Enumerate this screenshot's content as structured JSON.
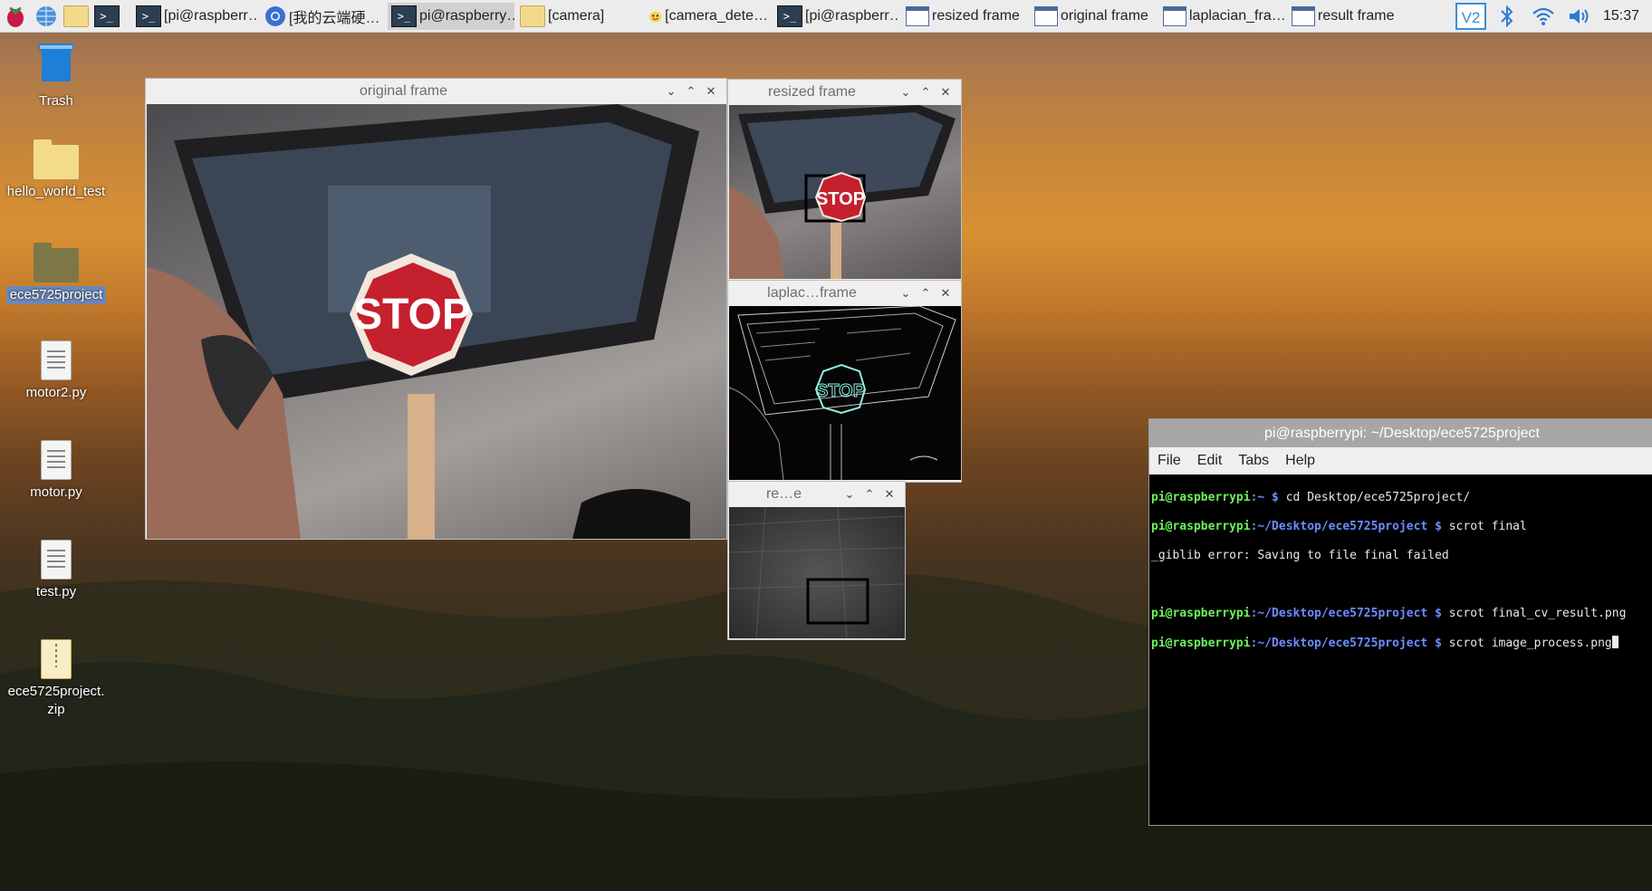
{
  "taskbar": {
    "launcher_icon": "raspberry-icon",
    "quick": [
      "globe-icon",
      "folder-icon",
      "terminal-icon"
    ],
    "tasks": [
      {
        "label": "[pi@raspberr…",
        "icon": "terminal",
        "active": false
      },
      {
        "label": "[我的云端硬…",
        "icon": "chrome",
        "active": false
      },
      {
        "label": "pi@raspberry…",
        "icon": "terminal",
        "active": true
      },
      {
        "label": "[camera]",
        "icon": "folder",
        "active": false
      },
      {
        "label": "[camera_dete…",
        "icon": "thonny",
        "active": false
      },
      {
        "label": "[pi@raspberr…",
        "icon": "terminal",
        "active": false
      },
      {
        "label": "resized frame",
        "icon": "window",
        "active": false
      },
      {
        "label": "original frame",
        "icon": "window",
        "active": false
      },
      {
        "label": "laplacian_fra…",
        "icon": "window",
        "active": false
      },
      {
        "label": "result frame",
        "icon": "window",
        "active": false
      }
    ],
    "tray": [
      "vnc-icon",
      "bluetooth-icon",
      "wifi-icon",
      "volume-icon"
    ],
    "clock": "15:37"
  },
  "desktop_icons": [
    {
      "label": "Trash",
      "icon": "trash",
      "selected": false
    },
    {
      "label": "hello_world_test",
      "icon": "folder",
      "selected": false
    },
    {
      "label": "ece5725project",
      "icon": "folder-dark",
      "selected": true
    },
    {
      "label": "motor2.py",
      "icon": "document",
      "selected": false
    },
    {
      "label": "motor.py",
      "icon": "document",
      "selected": false
    },
    {
      "label": "test.py",
      "icon": "document",
      "selected": false
    },
    {
      "label": "ece5725project.zip",
      "icon": "zip",
      "selected": false
    }
  ],
  "windows": {
    "original": {
      "title": "original frame",
      "stop_text": "STOP"
    },
    "resized": {
      "title": "resized frame",
      "stop_text": "STOP"
    },
    "laplacian": {
      "title": "laplac…frame",
      "stop_text": "STOP"
    },
    "result": {
      "title": "re…e"
    }
  },
  "terminal": {
    "title": "pi@raspberrypi: ~/Desktop/ece5725project",
    "menu": [
      "File",
      "Edit",
      "Tabs",
      "Help"
    ],
    "lines": [
      {
        "prompt_user": "pi@raspberrypi",
        "prompt_path": ":~ $",
        "cmd": " cd Desktop/ece5725project/"
      },
      {
        "prompt_user": "pi@raspberrypi",
        "prompt_path": ":~/Desktop/ece5725project $",
        "cmd": " scrot final"
      },
      {
        "prompt_user": "",
        "prompt_path": "",
        "cmd": "_giblib error: Saving to file final failed"
      },
      {
        "prompt_user": "",
        "prompt_path": "",
        "cmd": ""
      },
      {
        "prompt_user": "pi@raspberrypi",
        "prompt_path": ":~/Desktop/ece5725project $",
        "cmd": " scrot final_cv_result.png"
      },
      {
        "prompt_user": "pi@raspberrypi",
        "prompt_path": ":~/Desktop/ece5725project $",
        "cmd": " scrot image_process.png"
      }
    ]
  }
}
